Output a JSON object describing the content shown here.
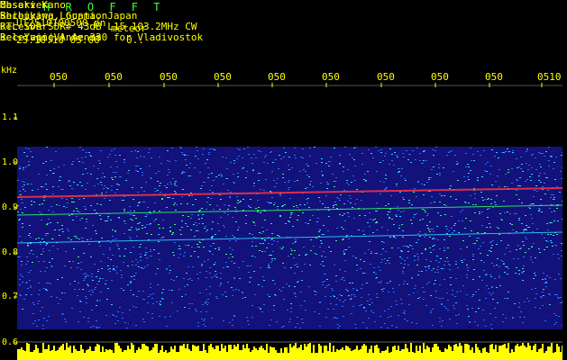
{
  "header": {
    "brand": "H R O F F T",
    "filename": "UT2510100500.pn",
    "type": "meteor",
    "datetime": "25.10.10 05:00",
    "count": "0..",
    "meta": {
      "labels": [
        "Observer",
        "Receiving Location",
        "Receiver",
        "Receiving Antenna"
      ],
      "colons": [
        ":",
        ":",
        ":",
        ":"
      ],
      "values": [
        "Masaki Kano",
        "Shibukawa, Gunma, Japan",
        "RTL-SDR SDR# 43dB L15 103.2MHz CW",
        "3el Yagi(V) Az 330 for Vladivostok"
      ]
    }
  },
  "axis": {
    "unit": "kHz",
    "time_labels": [
      "050",
      "050",
      "050",
      "050",
      "050",
      "050",
      "050",
      "050",
      "050",
      "0510"
    ],
    "freq_labels": [
      "1.1",
      "1.0",
      "0.9",
      "0.8",
      "0.7",
      "0.6"
    ]
  },
  "colors": {
    "text_yellow": "#ffff00",
    "text_green": "#3cff3c",
    "background": "#000000",
    "noise_dark": "#1a1aa0",
    "noise_blue": "#2e6cff",
    "noise_cyan": "#33d6ff",
    "noise_green": "#33ff66",
    "signal_red": "#ff3344",
    "level_bar": "#ffff00"
  }
}
